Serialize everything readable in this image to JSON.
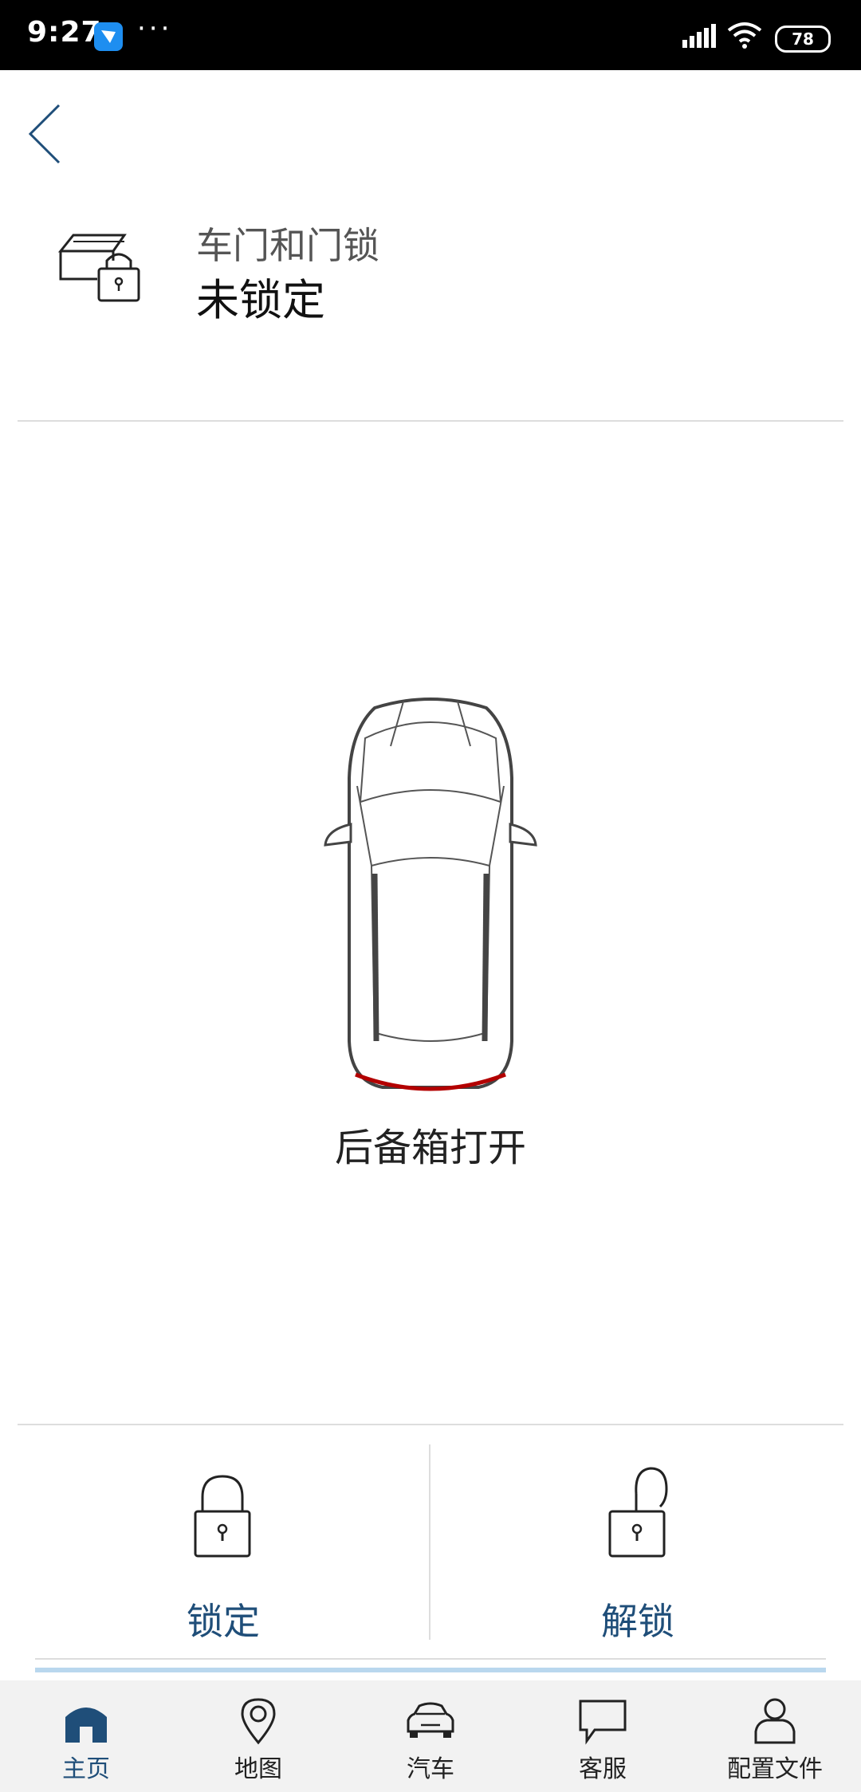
{
  "status_bar": {
    "time": "9:27",
    "dots": "···",
    "battery": "78"
  },
  "header": {
    "title": "车门和门锁",
    "status": "未锁定"
  },
  "car": {
    "caption": "后备箱打开"
  },
  "actions": {
    "lock_label": "锁定",
    "unlock_label": "解锁"
  },
  "nav": [
    {
      "label": "主页"
    },
    {
      "label": "地图"
    },
    {
      "label": "汽车"
    },
    {
      "label": "客服"
    },
    {
      "label": "配置文件"
    }
  ],
  "colors": {
    "accent": "#1f4e79",
    "alert": "#b30000",
    "tab_bar": "#f2f2f2"
  }
}
